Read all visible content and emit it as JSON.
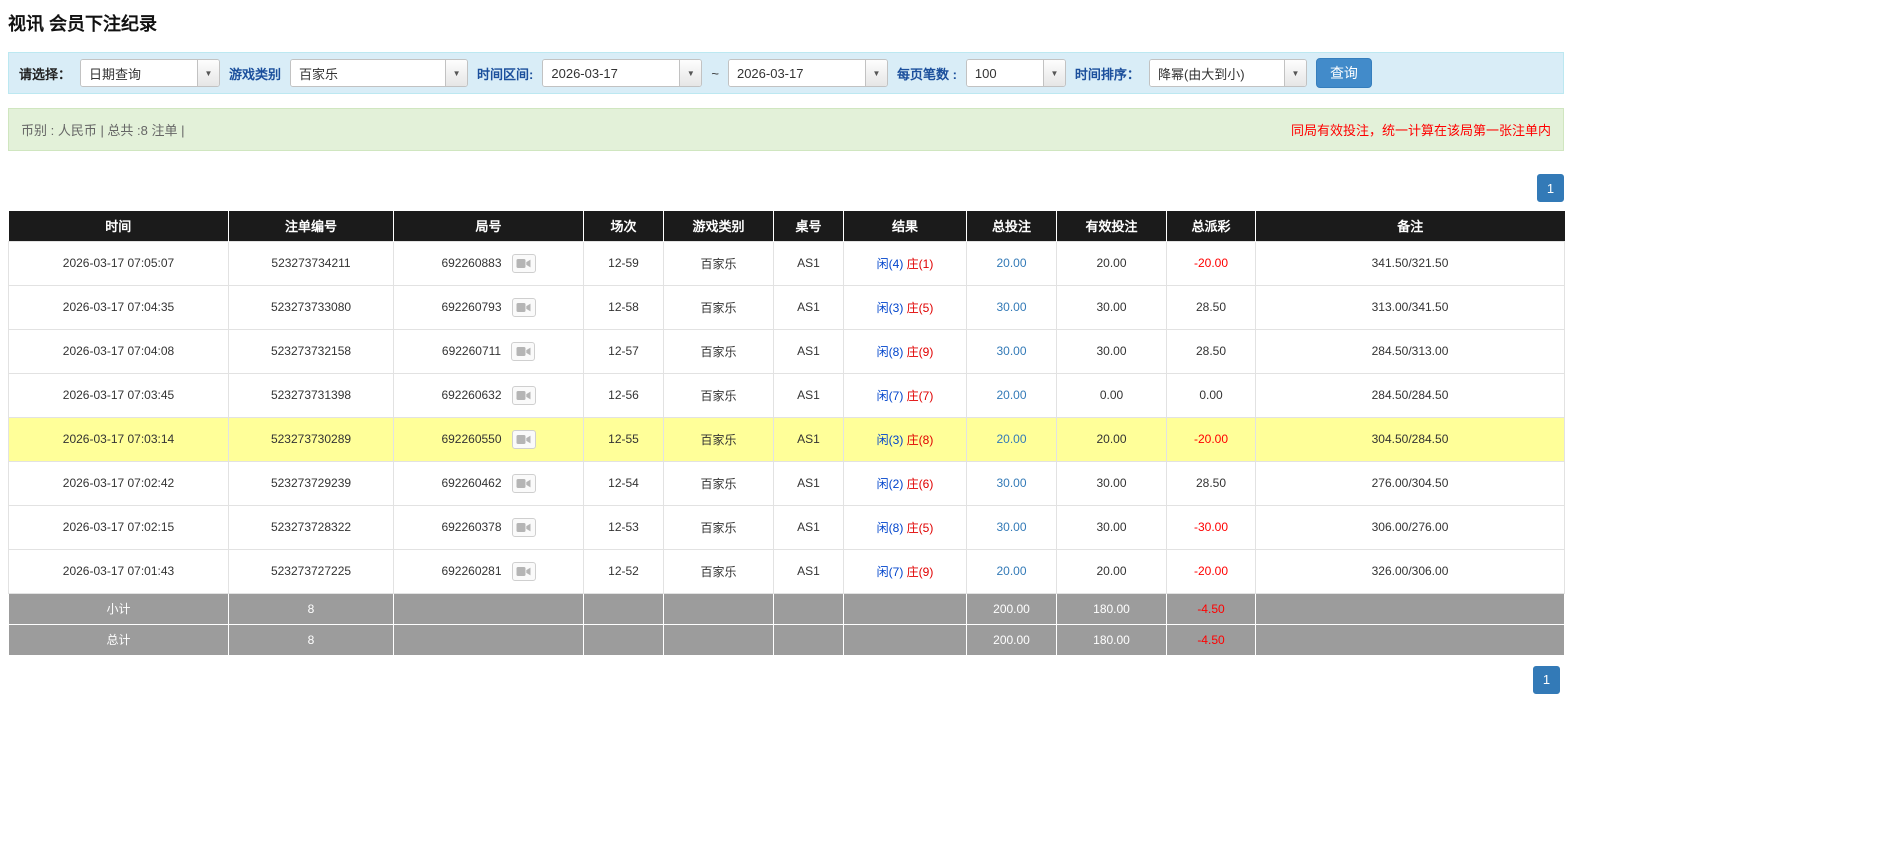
{
  "page": {
    "title": "视讯 会员下注纪录"
  },
  "filters": {
    "select_label": "请选择：",
    "select_value": "日期查询",
    "game_label": "游戏类别",
    "game_value": "百家乐",
    "range_label": "时间区间:",
    "date_from": "2026-03-17",
    "range_sep": "~",
    "date_to": "2026-03-17",
    "pagesize_label": "每页笔数 :",
    "pagesize_value": "100",
    "sort_label": "时间排序：",
    "sort_value": "降幂(由大到小)",
    "search_label": "查询"
  },
  "summary_bar": {
    "left_text": "币别 : 人民币 | 总共 :8 注单 |",
    "right_text": "同局有效投注，统一计算在该局第一张注单内"
  },
  "pagination": {
    "current_page": "1"
  },
  "table": {
    "headers": [
      "时间",
      "注单编号",
      "局号",
      "场次",
      "游戏类别",
      "桌号",
      "结果",
      "总投注",
      "有效投注",
      "总派彩",
      "备注"
    ],
    "rows": [
      {
        "time": "2026-03-17 07:05:07",
        "bet_no": "523273734211",
        "round_no": "692260883",
        "session": "12-59",
        "game": "百家乐",
        "table_no": "AS1",
        "result_player": "闲(4)",
        "result_banker": "庄(1)",
        "total_bet": "20.00",
        "valid_bet": "20.00",
        "payout": "-20.00",
        "remark": "341.50/321.50",
        "highlight": false
      },
      {
        "time": "2026-03-17 07:04:35",
        "bet_no": "523273733080",
        "round_no": "692260793",
        "session": "12-58",
        "game": "百家乐",
        "table_no": "AS1",
        "result_player": "闲(3)",
        "result_banker": "庄(5)",
        "total_bet": "30.00",
        "valid_bet": "30.00",
        "payout": "28.50",
        "remark": "313.00/341.50",
        "highlight": false
      },
      {
        "time": "2026-03-17 07:04:08",
        "bet_no": "523273732158",
        "round_no": "692260711",
        "session": "12-57",
        "game": "百家乐",
        "table_no": "AS1",
        "result_player": "闲(8)",
        "result_banker": "庄(9)",
        "total_bet": "30.00",
        "valid_bet": "30.00",
        "payout": "28.50",
        "remark": "284.50/313.00",
        "highlight": false
      },
      {
        "time": "2026-03-17 07:03:45",
        "bet_no": "523273731398",
        "round_no": "692260632",
        "session": "12-56",
        "game": "百家乐",
        "table_no": "AS1",
        "result_player": "闲(7)",
        "result_banker": "庄(7)",
        "total_bet": "20.00",
        "valid_bet": "0.00",
        "payout": "0.00",
        "remark": "284.50/284.50",
        "highlight": false
      },
      {
        "time": "2026-03-17 07:03:14",
        "bet_no": "523273730289",
        "round_no": "692260550",
        "session": "12-55",
        "game": "百家乐",
        "table_no": "AS1",
        "result_player": "闲(3)",
        "result_banker": "庄(8)",
        "total_bet": "20.00",
        "valid_bet": "20.00",
        "payout": "-20.00",
        "remark": "304.50/284.50",
        "highlight": true
      },
      {
        "time": "2026-03-17 07:02:42",
        "bet_no": "523273729239",
        "round_no": "692260462",
        "session": "12-54",
        "game": "百家乐",
        "table_no": "AS1",
        "result_player": "闲(2)",
        "result_banker": "庄(6)",
        "total_bet": "30.00",
        "valid_bet": "30.00",
        "payout": "28.50",
        "remark": "276.00/304.50",
        "highlight": false
      },
      {
        "time": "2026-03-17 07:02:15",
        "bet_no": "523273728322",
        "round_no": "692260378",
        "session": "12-53",
        "game": "百家乐",
        "table_no": "AS1",
        "result_player": "闲(8)",
        "result_banker": "庄(5)",
        "total_bet": "30.00",
        "valid_bet": "30.00",
        "payout": "-30.00",
        "remark": "306.00/276.00",
        "highlight": false
      },
      {
        "time": "2026-03-17 07:01:43",
        "bet_no": "523273727225",
        "round_no": "692260281",
        "session": "12-52",
        "game": "百家乐",
        "table_no": "AS1",
        "result_player": "闲(7)",
        "result_banker": "庄(9)",
        "total_bet": "20.00",
        "valid_bet": "20.00",
        "payout": "-20.00",
        "remark": "326.00/306.00",
        "highlight": false
      }
    ],
    "footer_rows": [
      {
        "label": "小计",
        "count": "8",
        "total_bet": "200.00",
        "valid_bet": "180.00",
        "payout": "-4.50"
      },
      {
        "label": "总计",
        "count": "8",
        "total_bet": "200.00",
        "valid_bet": "180.00",
        "payout": "-4.50"
      }
    ]
  },
  "colors": {
    "accent_blue": "#337ab7",
    "filter_bar_bg": "#d9edf7",
    "summary_bar_bg": "#e3f1d9",
    "header_bg": "#1b1b1b",
    "footer_bg": "#9c9c9c",
    "highlight_yellow": "#ffff99",
    "negative_red": "#ff0000",
    "player_blue": "#0044cc",
    "banker_red": "#e00000"
  }
}
